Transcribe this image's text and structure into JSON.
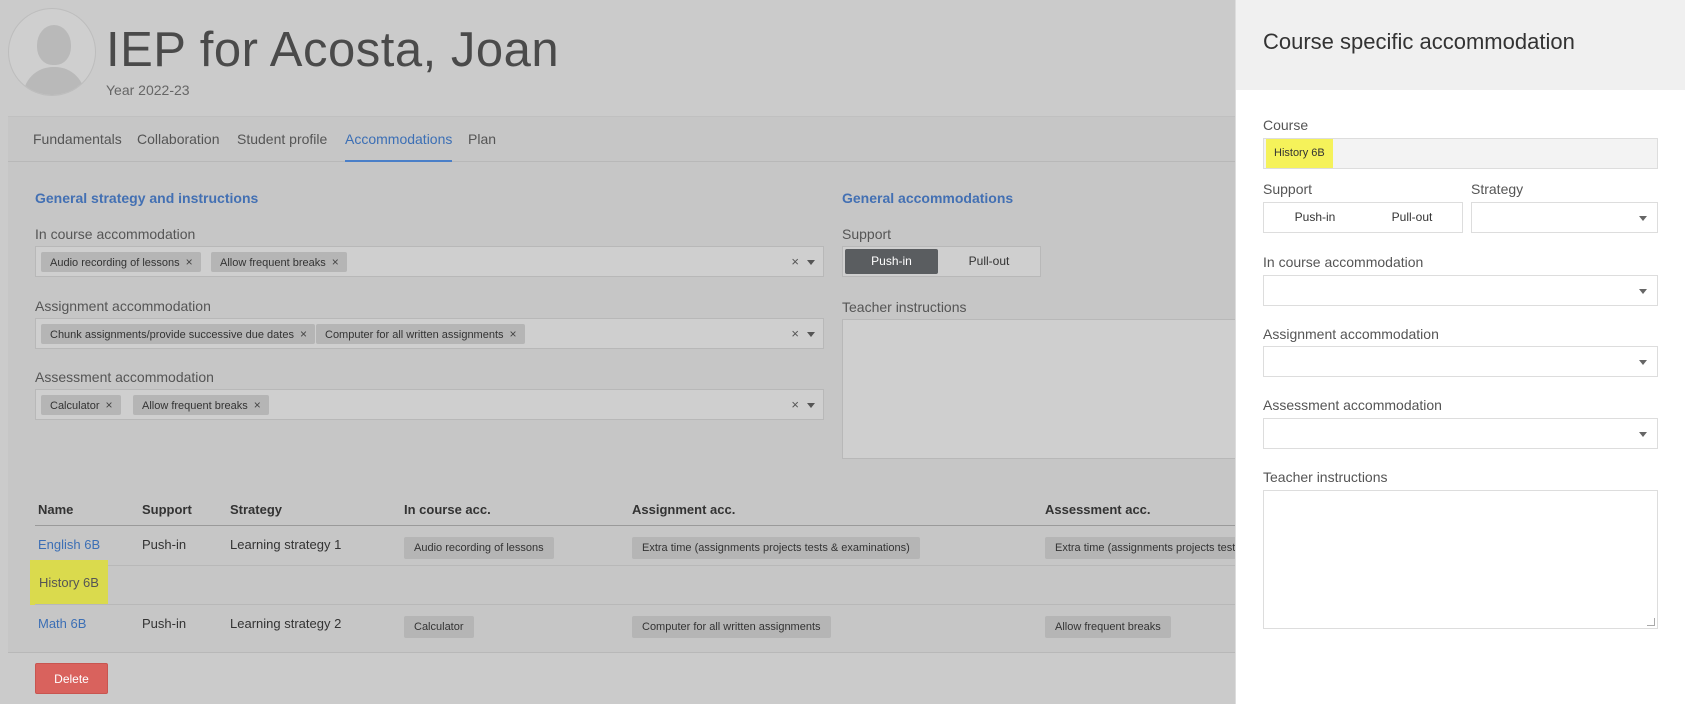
{
  "header": {
    "title": "IEP for Acosta, Joan",
    "year": "Year 2022-23"
  },
  "tabs": [
    {
      "label": "Fundamentals"
    },
    {
      "label": "Collaboration"
    },
    {
      "label": "Student profile"
    },
    {
      "label": "Accommodations",
      "active": true
    },
    {
      "label": "Plan"
    }
  ],
  "general_strategy": {
    "title": "General strategy and instructions",
    "in_course": {
      "label": "In course accommodation",
      "chips": [
        "Audio recording of lessons",
        "Allow frequent breaks"
      ]
    },
    "assignment": {
      "label": "Assignment accommodation",
      "chips": [
        "Chunk assignments/provide successive due dates",
        "Computer for all written assignments"
      ]
    },
    "assessment": {
      "label": "Assessment accommodation",
      "chips": [
        "Calculator",
        "Allow frequent breaks"
      ]
    },
    "chip_remove": "×",
    "clear_icon": "×"
  },
  "general_accommodations": {
    "title": "General accommodations",
    "support_label": "Support",
    "support_options": [
      "Push-in",
      "Pull-out"
    ],
    "support_selected": "Push-in",
    "teacher_label": "Teacher instructions"
  },
  "table": {
    "headers": [
      "Name",
      "Support",
      "Strategy",
      "In course acc.",
      "Assignment acc.",
      "Assessment acc."
    ],
    "rows": [
      {
        "name": "English 6B",
        "support": "Push-in",
        "strategy": "Learning strategy 1",
        "in_course": "Audio recording of lessons",
        "assignment": "Extra time (assignments projects tests & examinations)",
        "assessment": "Extra time (assignments projects tests"
      },
      {
        "name": "History 6B",
        "support": "",
        "strategy": "",
        "in_course": "",
        "assignment": "",
        "assessment": "",
        "highlighted": true
      },
      {
        "name": "Math 6B",
        "support": "Push-in",
        "strategy": "Learning strategy 2",
        "in_course": "Calculator",
        "assignment": "Computer for all written assignments",
        "assessment": "Allow frequent breaks"
      }
    ]
  },
  "delete_label": "Delete",
  "panel": {
    "title": "Course specific accommodation",
    "course_label": "Course",
    "course_value": "History 6B",
    "support_label": "Support",
    "support_options": [
      "Push-in",
      "Pull-out"
    ],
    "strategy_label": "Strategy",
    "in_course_label": "In course accommodation",
    "assignment_label": "Assignment accommodation",
    "assessment_label": "Assessment accommodation",
    "teacher_label": "Teacher instructions"
  },
  "colors": {
    "accent": "#4a7fc8",
    "highlight": "#f5f25a",
    "danger": "#d9625d"
  }
}
